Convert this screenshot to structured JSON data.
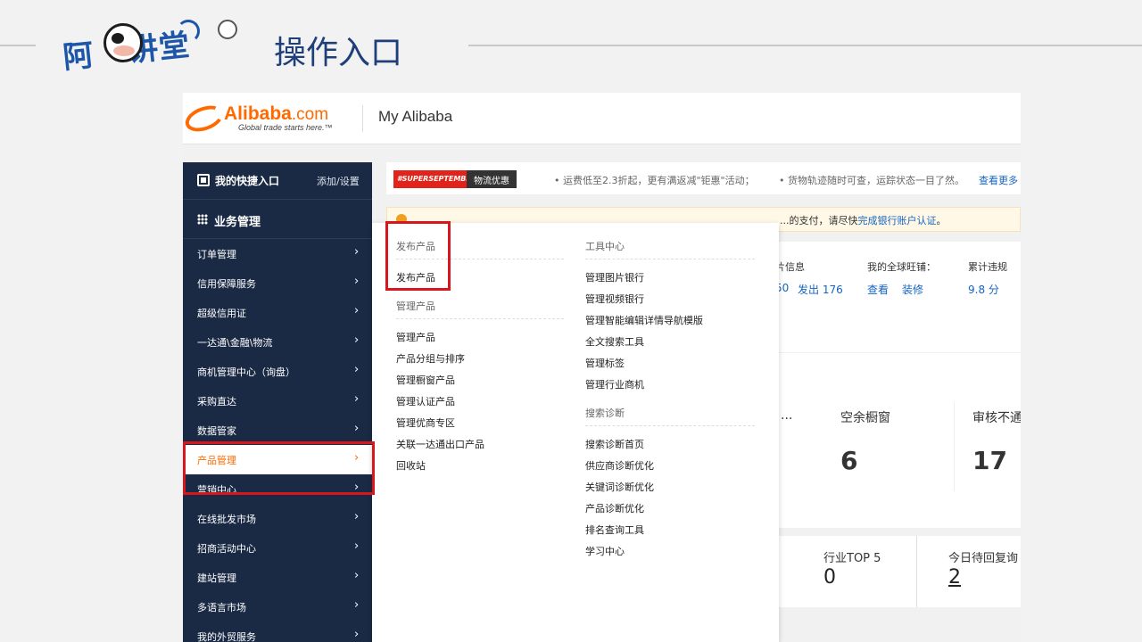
{
  "slide": {
    "logo_text_1": "阿",
    "logo_text_2": "讲堂",
    "title": "操作入口"
  },
  "header": {
    "brand": "Alibaba",
    "brand_suffix": ".com",
    "tagline": "Global trade starts here.™",
    "page_title": "My Alibaba"
  },
  "sidebar": {
    "quick_label": "我的快捷入口",
    "quick_action": "添加/设置",
    "section_label": "业务管理",
    "items": [
      {
        "label": "订单管理"
      },
      {
        "label": "信用保障服务"
      },
      {
        "label": "超级信用证"
      },
      {
        "label": "一达通\\金融\\物流"
      },
      {
        "label": "商机管理中心（询盘）"
      },
      {
        "label": "采购直达"
      },
      {
        "label": "数据管家"
      },
      {
        "label": "产品管理"
      },
      {
        "label": "营销中心"
      },
      {
        "label": "在线批发市场"
      },
      {
        "label": "招商活动中心"
      },
      {
        "label": "建站管理"
      },
      {
        "label": "多语言市场"
      },
      {
        "label": "我的外贸服务"
      }
    ],
    "active_index": 7
  },
  "promo": {
    "badge": "#SUPERSEPTEMBER",
    "badge2": "物流优惠",
    "text1": "• 运费低至2.3折起，更有满返减\"钜惠\"活动；",
    "text2": "• 货物轨迹随时可查，运踪状态一目了然。",
    "more": "查看更多"
  },
  "notice": {
    "text": "...的支付，请尽快",
    "link": "完成银行账户认证",
    "end": "。"
  },
  "stats": {
    "col1_label": "片信息",
    "col1_v1": "50",
    "col1_v2": "发出 176",
    "col2_label": "我的全球旺铺：",
    "col2_v1": "查看",
    "col2_v2": "装修",
    "col3_label": "累计违规",
    "col3_v": "9.8 分"
  },
  "showcase": {
    "ellipsis": "...",
    "label1": "空余橱窗",
    "value1": "6",
    "label2": "审核不通",
    "value2": "17"
  },
  "bottom": {
    "label1": "行业TOP 5",
    "value1": "0",
    "label2": "今日待回复询",
    "value2": "2"
  },
  "dropdown": {
    "col_a": [
      {
        "heading": "发布产品",
        "items": [
          "发布产品"
        ]
      },
      {
        "heading": "管理产品",
        "items": [
          "管理产品",
          "产品分组与排序",
          "管理橱窗产品",
          "管理认证产品",
          "管理优商专区",
          "关联一达通出口产品",
          "回收站"
        ]
      }
    ],
    "col_b": [
      {
        "heading": "工具中心",
        "items": [
          "管理图片银行",
          "管理视频银行",
          "管理智能编辑详情导航模版",
          "全文搜索工具",
          "管理标签",
          "管理行业商机"
        ]
      },
      {
        "heading": "搜索诊断",
        "items": [
          "搜索诊断首页",
          "供应商诊断优化",
          "关键词诊断优化",
          "产品诊断优化",
          "排名查询工具",
          "学习中心"
        ]
      }
    ]
  },
  "colors": {
    "brand_orange": "#ff6a00",
    "sidebar_bg": "#1a2a44",
    "highlight_red": "#d6171d",
    "link_blue": "#1664c0"
  }
}
